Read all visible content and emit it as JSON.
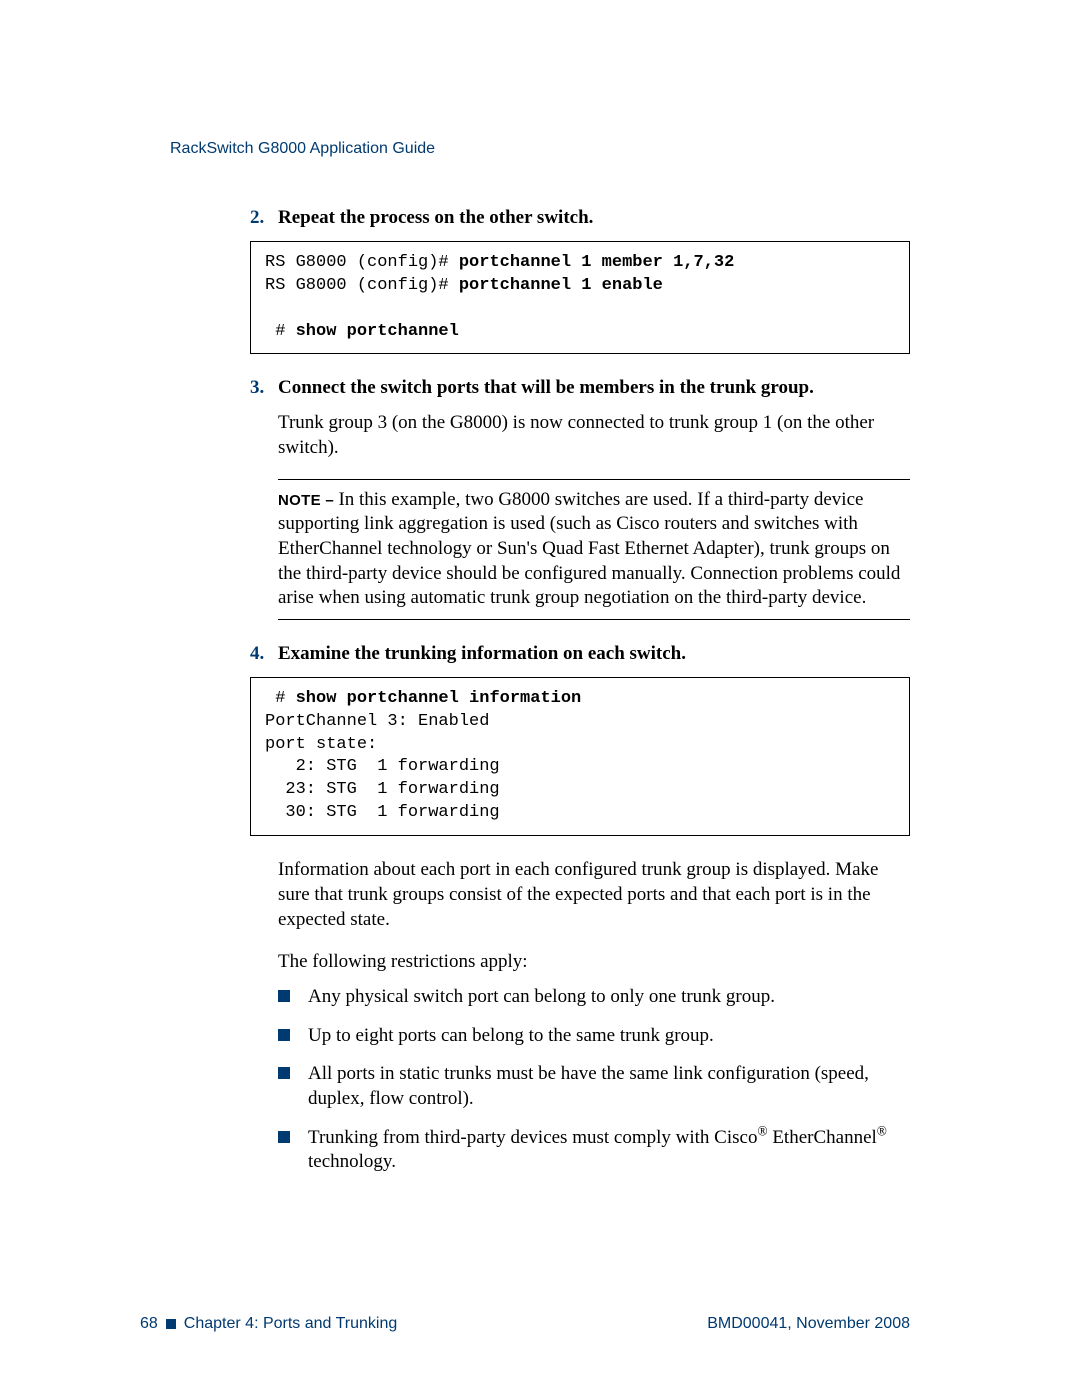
{
  "running_head": "RackSwitch G8000  Application Guide",
  "steps": {
    "s2": {
      "num": "2.",
      "title": "Repeat the process on the other switch.",
      "code_plain1": "RS G8000 (config)# ",
      "code_bold1": "portchannel 1 member 1,7,32",
      "code_plain2": "RS G8000 (config)# ",
      "code_bold2": "portchannel 1 enable",
      "code_plain3": " # ",
      "code_bold3": "show portchannel"
    },
    "s3": {
      "num": "3.",
      "title": "Connect the switch ports that will be members in the trunk group.",
      "body": "Trunk group 3 (on the G8000) is now connected to trunk group 1 (on the other switch).",
      "note_label": "NOTE – ",
      "note_body": "In this example, two G8000 switches are used. If a third-party device supporting link aggregation is used (such as Cisco routers and switches with EtherChannel technology or Sun's Quad Fast Ethernet Adapter), trunk groups on the third-party device should be configured manually. Connection problems could arise when using automatic trunk group negotiation on the third-party device."
    },
    "s4": {
      "num": "4.",
      "title": "Examine the trunking information on each switch.",
      "code_plain1": " # ",
      "code_bold1": "show portchannel information",
      "code_rest": "PortChannel 3: Enabled\nport state:\n   2: STG  1 forwarding\n  23: STG  1 forwarding\n  30: STG  1 forwarding",
      "body1": "Information about each port in each configured trunk group is displayed. Make sure that trunk groups consist of the expected ports and that each port is in the expected state.",
      "body2": "The following restrictions apply:",
      "bullets": {
        "b1": "Any physical switch port can belong to only one trunk group.",
        "b2": "Up to eight ports can belong to the same trunk group.",
        "b3": "All ports in static trunks must be have the same link configuration (speed, duplex, flow control).",
        "b4_a": "Trunking from third-party devices must comply with Cisco",
        "b4_b": " EtherChannel",
        "b4_c": " technology."
      }
    }
  },
  "footer": {
    "page": "68",
    "chapter": "Chapter 4:  Ports and Trunking",
    "doc": "BMD00041, November 2008"
  },
  "reg": "®"
}
